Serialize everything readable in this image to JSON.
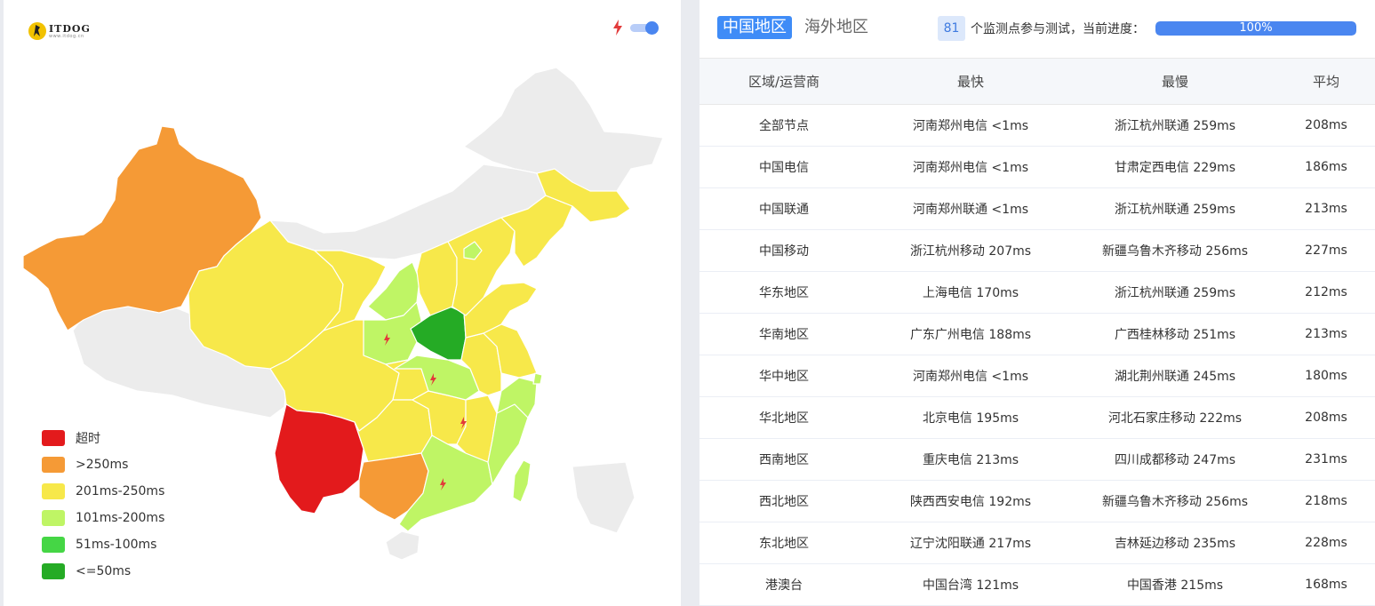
{
  "logo": {
    "name": "ITDOG",
    "url": "www.itdog.cn"
  },
  "speed_toggle": {
    "on": true
  },
  "legend": [
    {
      "label": "超时",
      "color": "#e31a1c"
    },
    {
      "label": ">250ms",
      "color": "#f59a36"
    },
    {
      "label": "201ms-250ms",
      "color": "#f7e84a"
    },
    {
      "label": "101ms-200ms",
      "color": "#bff565"
    },
    {
      "label": "51ms-100ms",
      "color": "#45d645"
    },
    {
      "label": "<=50ms",
      "color": "#25ab25"
    }
  ],
  "map_colors": {
    "no_data": "#ececec",
    "border": "#ffffff",
    "bolt": "#e23a3a"
  },
  "tabs": [
    {
      "label": "中国地区",
      "active": true
    },
    {
      "label": "海外地区",
      "active": false
    }
  ],
  "progress": {
    "count": "81",
    "text": "个监测点参与测试，当前进度：",
    "percent_label": "100%",
    "fraction": 1.0
  },
  "table": {
    "headers": [
      "区域/运营商",
      "最快",
      "最慢",
      "平均"
    ],
    "rows": [
      [
        "全部节点",
        "河南郑州电信 <1ms",
        "浙江杭州联通 259ms",
        "208ms"
      ],
      [
        "中国电信",
        "河南郑州电信 <1ms",
        "甘肃定西电信 229ms",
        "186ms"
      ],
      [
        "中国联通",
        "河南郑州联通 <1ms",
        "浙江杭州联通 259ms",
        "213ms"
      ],
      [
        "中国移动",
        "浙江杭州移动 207ms",
        "新疆乌鲁木齐移动 256ms",
        "227ms"
      ],
      [
        "华东地区",
        "上海电信 170ms",
        "浙江杭州联通 259ms",
        "212ms"
      ],
      [
        "华南地区",
        "广东广州电信 188ms",
        "广西桂林移动 251ms",
        "213ms"
      ],
      [
        "华中地区",
        "河南郑州电信 <1ms",
        "湖北荆州联通 245ms",
        "180ms"
      ],
      [
        "华北地区",
        "北京电信 195ms",
        "河北石家庄移动 222ms",
        "208ms"
      ],
      [
        "西南地区",
        "重庆电信 213ms",
        "四川成都移动 247ms",
        "231ms"
      ],
      [
        "西北地区",
        "陕西西安电信 192ms",
        "新疆乌鲁木齐移动 256ms",
        "218ms"
      ],
      [
        "东北地区",
        "辽宁沈阳联通 217ms",
        "吉林延边移动 235ms",
        "228ms"
      ],
      [
        "港澳台",
        "中国台湾 121ms",
        "中国香港 215ms",
        "168ms"
      ]
    ]
  }
}
